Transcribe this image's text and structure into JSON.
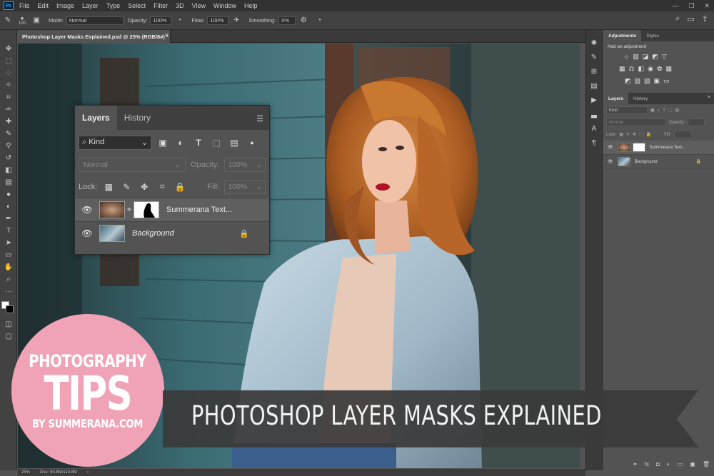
{
  "app": {
    "logo": "Ps"
  },
  "menu": [
    "File",
    "Edit",
    "Image",
    "Layer",
    "Type",
    "Select",
    "Filter",
    "3D",
    "View",
    "Window",
    "Help"
  ],
  "options": {
    "brush_size": "100",
    "mode_label": "Mode:",
    "mode_value": "Normal",
    "opacity_label": "Opacity:",
    "opacity_value": "100%",
    "flow_label": "Flow:",
    "flow_value": "100%",
    "smoothing_label": "Smoothing:",
    "smoothing_value": "0%"
  },
  "document": {
    "tab_title": "Photoshop Layer Masks Explained.psd @ 25% (RGB/8#) *",
    "zoom": "25%",
    "doc_size": "Doc: 50.8M/119.8M"
  },
  "layers_panel": {
    "tabs": [
      "Layers",
      "History"
    ],
    "kind": "Kind",
    "blend_mode": "Normal",
    "opacity_label": "Opacity:",
    "opacity_value": "100%",
    "lock_label": "Lock:",
    "fill_label": "Fill:",
    "fill_value": "100%",
    "layers": [
      {
        "name": "Summerana Text...",
        "has_mask": true
      },
      {
        "name": "Background",
        "locked": true
      }
    ]
  },
  "right_panel": {
    "top_tabs": [
      "Adjustments",
      "Styles"
    ],
    "add_adjustment": "Add an adjustment",
    "layer_tabs": [
      "Layers",
      "History"
    ],
    "kind": "Kind",
    "blend_mode": "Normal",
    "opacity_label": "Opacity:",
    "lock_label": "Lock:",
    "fill_label": "Fill:",
    "layers": [
      "Summerana Text...",
      "Background"
    ]
  },
  "badge": {
    "line1": "PHOTOGRAPHY",
    "line2": "TIPS",
    "line3": "BY SUMMERANA.COM",
    "color": "#f0a3b7"
  },
  "banner": {
    "text": "PHOTOSHOP LAYER MASKS EXPLAINED",
    "color": "#3a3a3a"
  }
}
